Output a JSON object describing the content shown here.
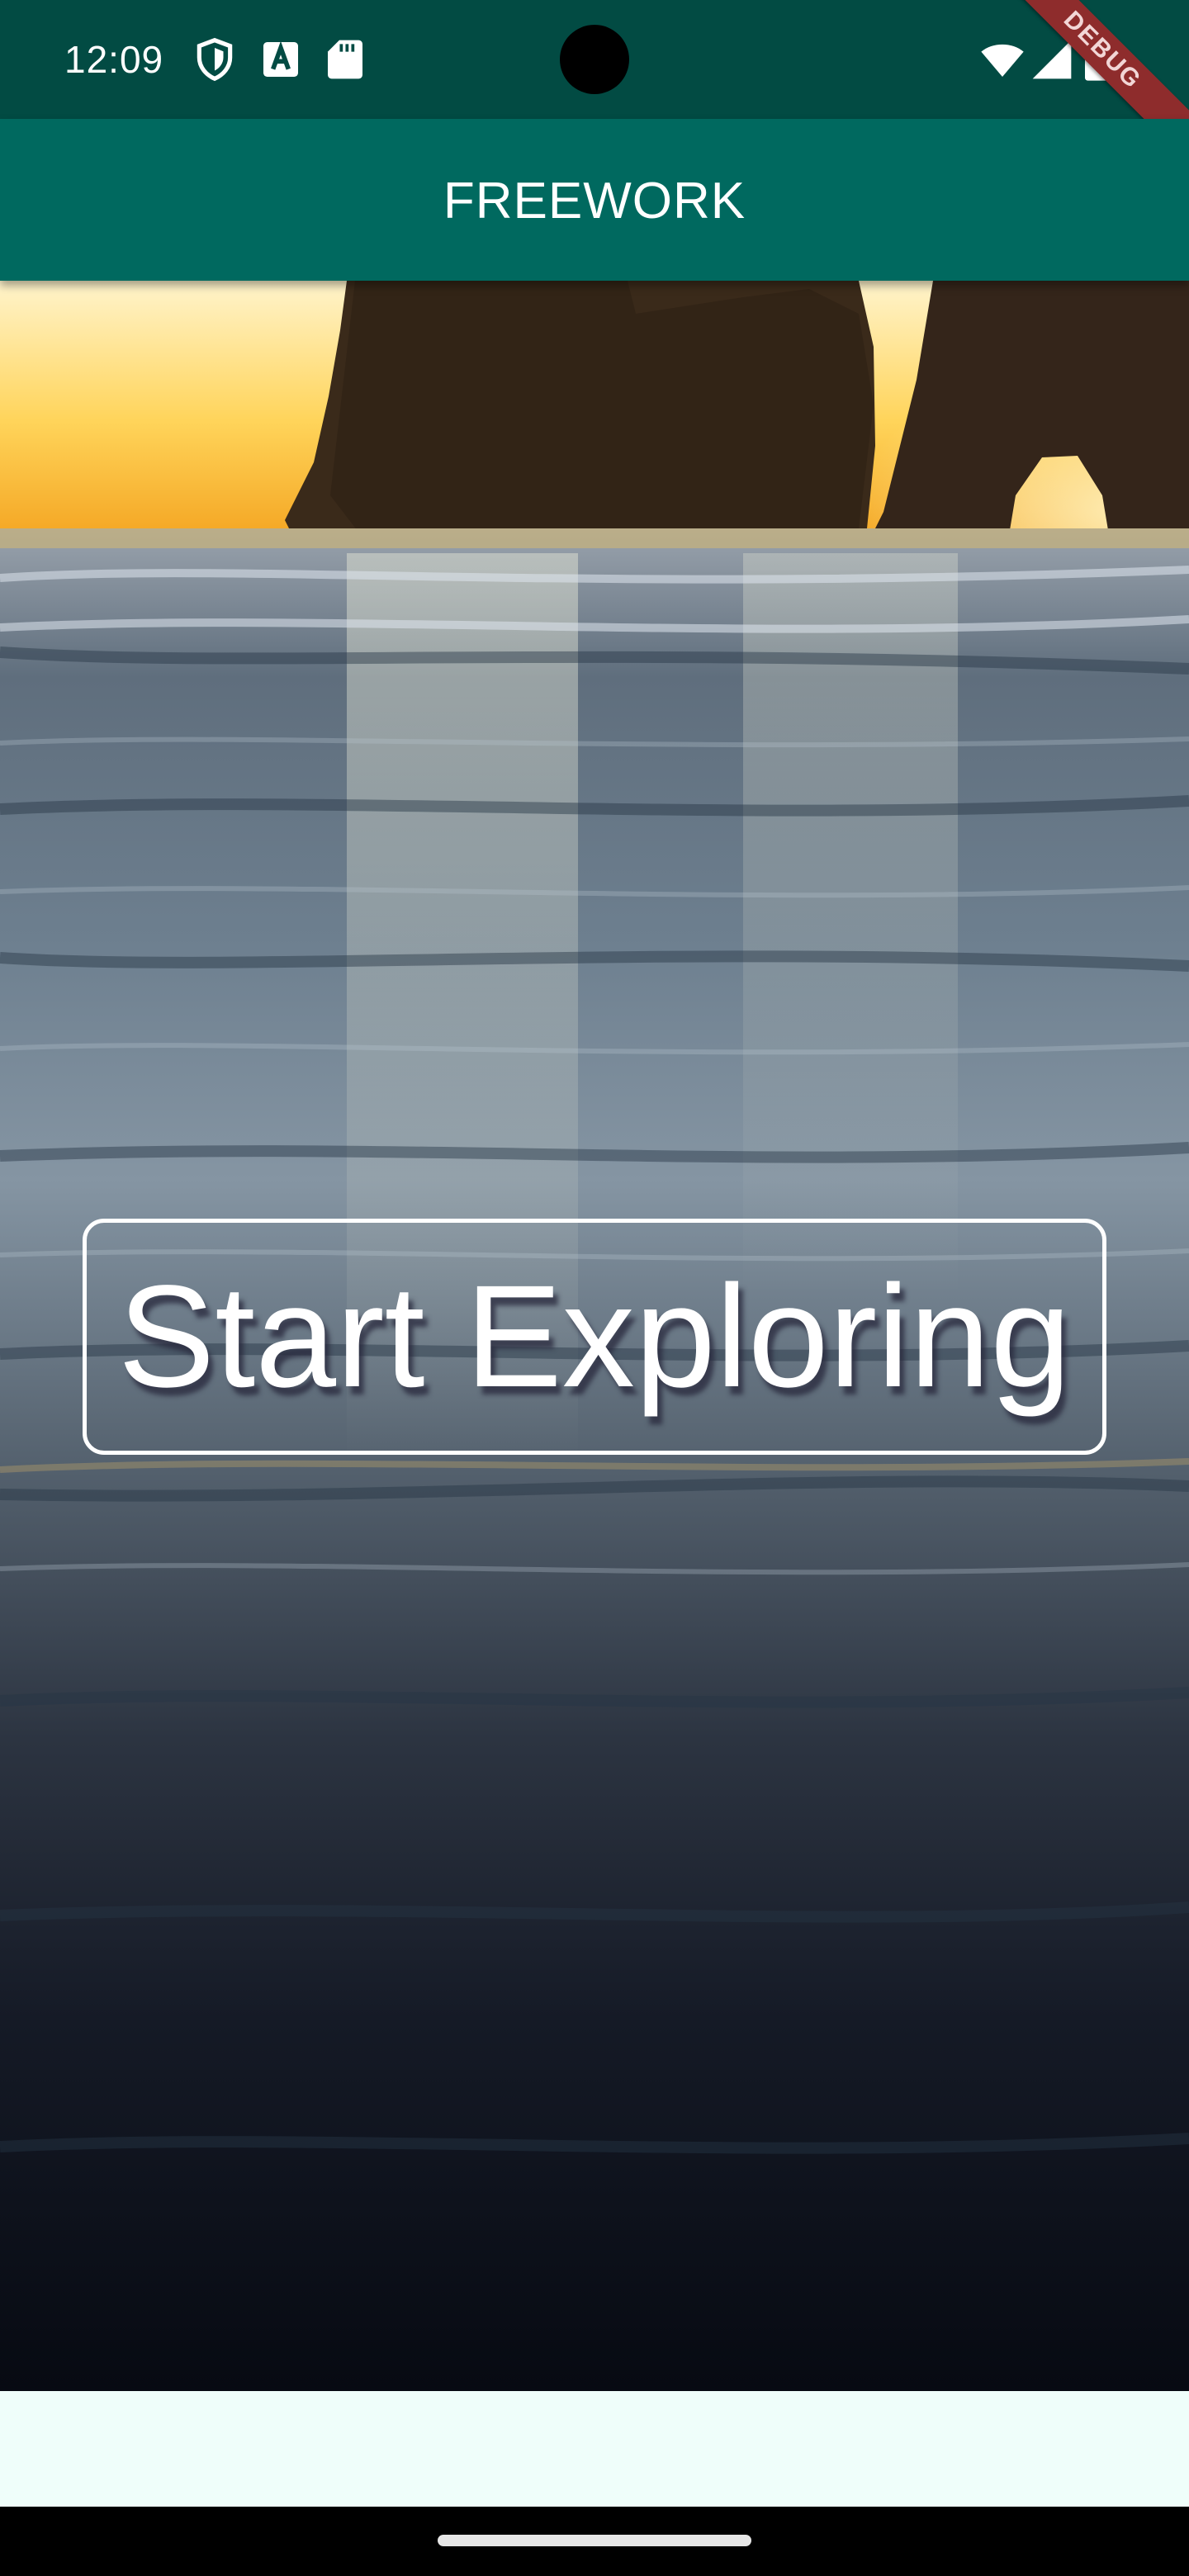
{
  "status_bar": {
    "time": "12:09",
    "left_icons": [
      "shield-icon",
      "text-a-icon",
      "sd-card-icon"
    ],
    "right_icons": [
      "wifi-icon",
      "cell-signal-icon",
      "battery-icon"
    ],
    "debug_banner": "DEBUG"
  },
  "app_bar": {
    "title": "FREEWORK"
  },
  "main": {
    "button_label": "Start Exploring"
  },
  "colors": {
    "status_bar": "#024b43",
    "app_bar": "#00695f",
    "bottom_strip": "#effefa",
    "debug_ribbon": "#8e2c2c"
  }
}
